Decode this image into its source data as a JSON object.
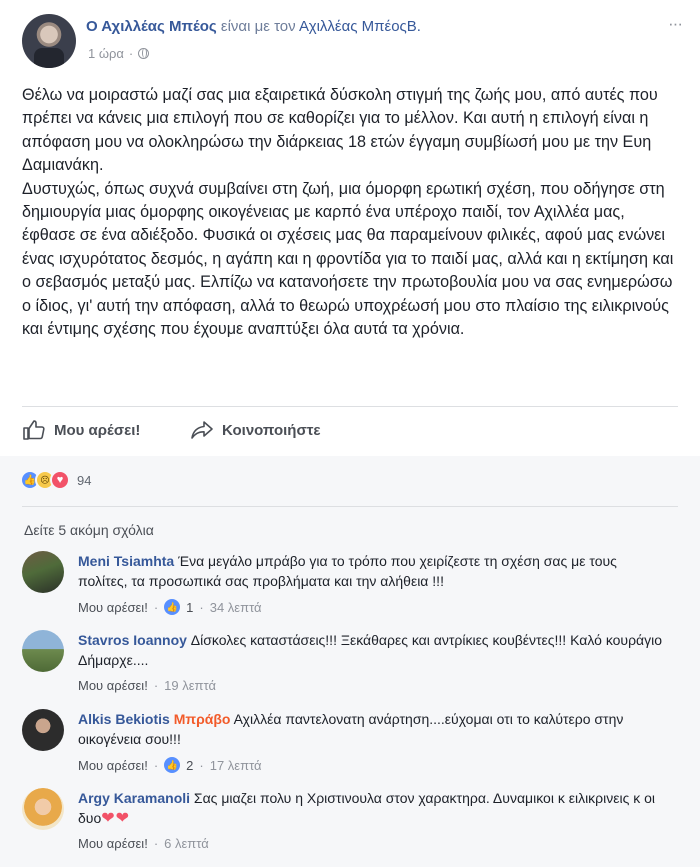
{
  "post": {
    "author": "Ο Αχιλλέας Μπέος",
    "verb": "είναι με τον",
    "tagged": "Αχιλλέας ΜπέοςΒ.",
    "time": "1 ώρα",
    "more_label": "···",
    "paragraph1": "Θέλω να μοιραστώ μαζί σας μια εξαιρετικά δύσκολη στιγμή της ζωής μου, από αυτές που πρέπει να κάνεις μια επιλογή που σε καθορίζει για το μέλλον. Και αυτή η επιλογή είναι η απόφαση μου να ολοκληρώσω την διάρκειας 18 ετών έγγαμη συμβίωσή μου με την Ευη Δαμιανάκη.",
    "paragraph2": "Δυστυχώς, όπως συχνά συμβαίνει στη ζωή, μια όμορφη ερωτική σχέση, που οδήγησε στη δημιουργία μιας όμορφης οικογένειας με καρπό ένα υπέροχο παιδί, τον Αχιλλέα μας, έφθασε σε ένα αδιέξοδο. Φυσικά οι σχέσεις μας θα παραμείνουν φιλικές, αφού μας ενώνει ένας ισχυρότατος δεσμός, η αγάπη και η φροντίδα για το παιδί μας, αλλά και η εκτίμηση και ο σεβασμός μεταξύ μας. Ελπίζω να κατανοήσετε την πρωτοβουλία μου να σας ενημερώσω ο ίδιος, γι' αυτή την απόφαση, αλλά το θεωρώ υποχρέωσή μου στο πλαίσιο της ειλικρινούς και έντιμης σχέσης που έχουμε αναπτύξει όλα αυτά τα χρόνια."
  },
  "actions": {
    "like_label": "Μου αρέσει!",
    "share_label": "Κοινοποιήστε"
  },
  "reactions": {
    "count": "94",
    "types": [
      "like-icon",
      "sad-icon",
      "love-icon"
    ],
    "colors": {
      "like": "#5890ff",
      "sad": "#f7c94b",
      "love": "#f25268"
    }
  },
  "comments_section": {
    "more_label": "Δείτε 5 ακόμη σχόλια",
    "items": [
      {
        "author": "Meni Tsiamhta",
        "tag": "",
        "text": " Ένα μεγάλο μπράβο για το τρόπο που χειρίζεστε τη σχέση σας με τους πολίτες, τα προσωπικά σας προβλήματα και την αλήθεια !!!",
        "like_label": "Μου αρέσει!",
        "likes": "1",
        "time": "34 λεπτά"
      },
      {
        "author": "Stavros Ioannoy",
        "tag": "",
        "text": " Δίσκολες καταστάσεις!!! Ξεκάθαρες και αντρίκιες κουβέντες!!! Καλό κουράγιο Δήμαρχε....",
        "like_label": "Μου αρέσει!",
        "likes": "",
        "time": "19 λεπτά"
      },
      {
        "author": "Alkis Bekiotis",
        "tag": "Μπράβο",
        "text": " Αχιλλέα παντελονατη ανάρτηση....εύχομαι οτι το καλύτερο στην οικογένεια σου!!!",
        "like_label": "Μου αρέσει!",
        "likes": "2",
        "time": "17 λεπτά"
      },
      {
        "author": "Argy Karamanoli",
        "tag": "",
        "text": " Σας μιαζει πολυ η Χριστινουλα στον χαρακτηρα. Δυναμικοι κ ειλικρινεις κ οι δυο",
        "emoji": "❤❤",
        "like_label": "Μου αρέσει!",
        "likes": "",
        "time": "6 λεπτά"
      }
    ]
  },
  "separator": "·"
}
